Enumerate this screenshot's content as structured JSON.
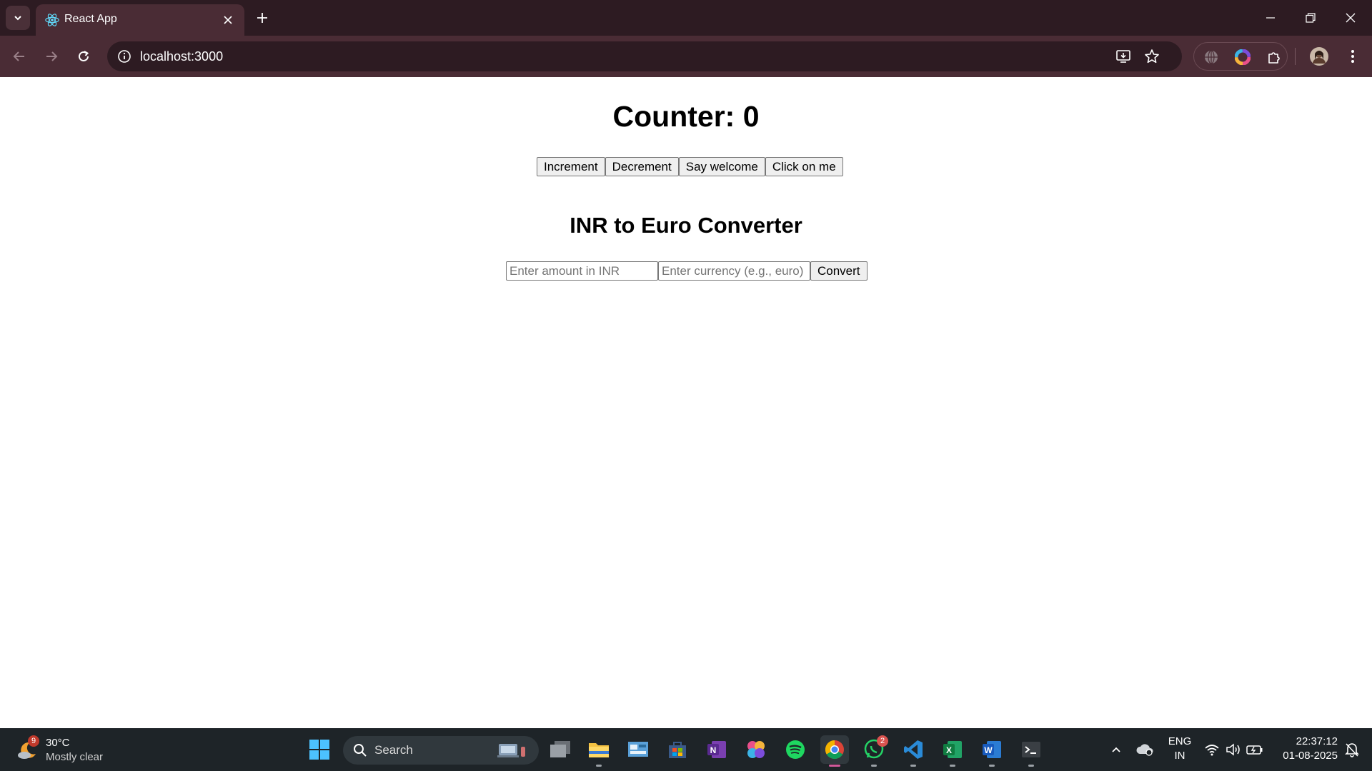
{
  "browser": {
    "tab_title": "React App",
    "url": "localhost:3000",
    "icons": {
      "tab_list": "chevron-down-icon",
      "favicon": "react-icon",
      "tab_close": "close-icon",
      "new_tab": "plus-icon",
      "back": "back-arrow-icon",
      "forward": "forward-arrow-icon",
      "reload": "reload-icon",
      "site_info": "info-icon",
      "install": "install-app-icon",
      "bookmark": "star-icon",
      "extensions": [
        "globe-extension-icon",
        "color-wheel-extension-icon",
        "puzzle-icon"
      ],
      "profile": "avatar",
      "menu": "kebab-menu-icon"
    },
    "colors": {
      "chrome_dark": "#2d1b22",
      "chrome_mid": "#4a2c35"
    }
  },
  "app": {
    "counter_title": "Counter: 0",
    "buttons": {
      "increment": "Increment",
      "decrement": "Decrement",
      "say_welcome": "Say welcome",
      "click_on_me": "Click on me"
    },
    "converter": {
      "title": "INR to Euro Converter",
      "amount_value": "",
      "amount_placeholder": "Enter amount in INR",
      "currency_value": "",
      "currency_placeholder": "Enter currency (e.g., euro)",
      "convert_label": "Convert"
    }
  },
  "taskbar": {
    "weather": {
      "badge": "9",
      "temp": "30°C",
      "desc": "Mostly clear"
    },
    "search_label": "Search",
    "apps": [
      {
        "name": "start-icon"
      },
      {
        "name": "task-view-icon"
      },
      {
        "name": "file-explorer-icon"
      },
      {
        "name": "control-panel-icon"
      },
      {
        "name": "microsoft-store-icon"
      },
      {
        "name": "onenote-icon"
      },
      {
        "name": "photos-icon"
      },
      {
        "name": "spotify-icon"
      },
      {
        "name": "chrome-icon",
        "active": true
      },
      {
        "name": "whatsapp-icon",
        "badge": "2"
      },
      {
        "name": "vscode-icon"
      },
      {
        "name": "excel-icon"
      },
      {
        "name": "word-icon"
      },
      {
        "name": "terminal-icon"
      }
    ],
    "tray": {
      "language": "ENG",
      "region": "IN",
      "time": "22:37:12",
      "date": "01-08-2025"
    }
  }
}
